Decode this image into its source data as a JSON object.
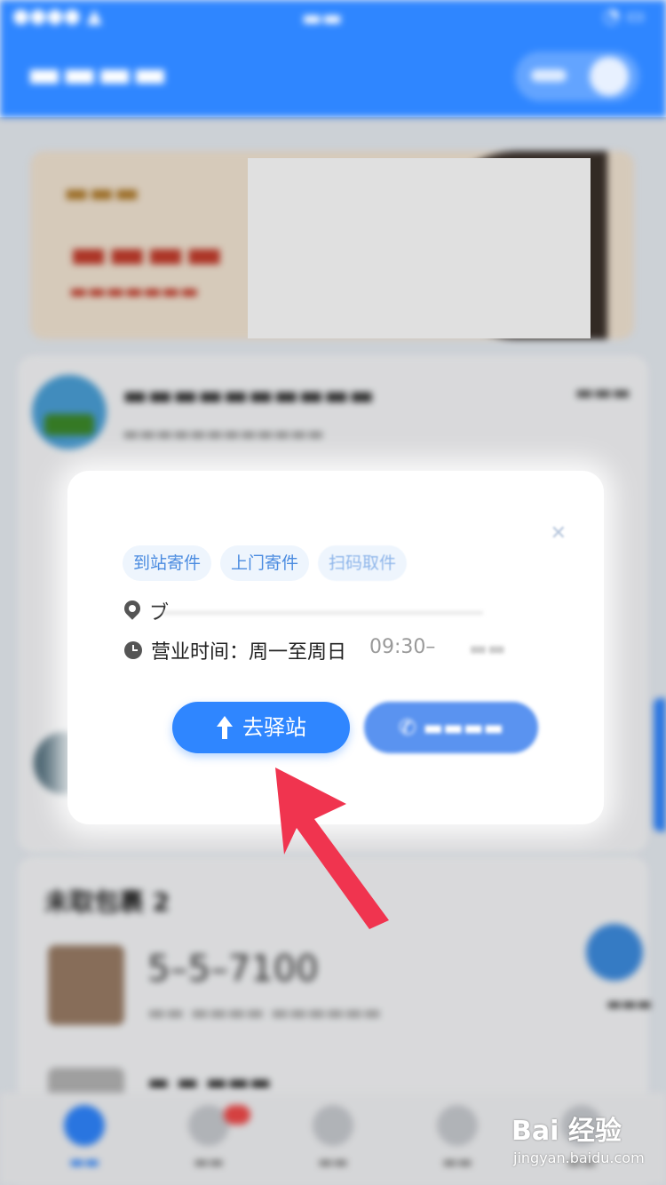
{
  "modal": {
    "tags": [
      "到站寄件",
      "上门寄件",
      "扫码取件"
    ],
    "address_text": "ブ",
    "hours_label": "营业时间：周一至周日",
    "hours_value": "09:30–",
    "go_button_label": "去驿站"
  },
  "packages": {
    "title": "未取包裹 2",
    "items": [
      {
        "code": "5–5–7100"
      }
    ]
  },
  "watermark": {
    "logo": "Bai 经验",
    "url": "jingyan.baidu.com"
  },
  "colors": {
    "primary": "#2f86ff",
    "annotation_arrow": "#f0344f"
  }
}
